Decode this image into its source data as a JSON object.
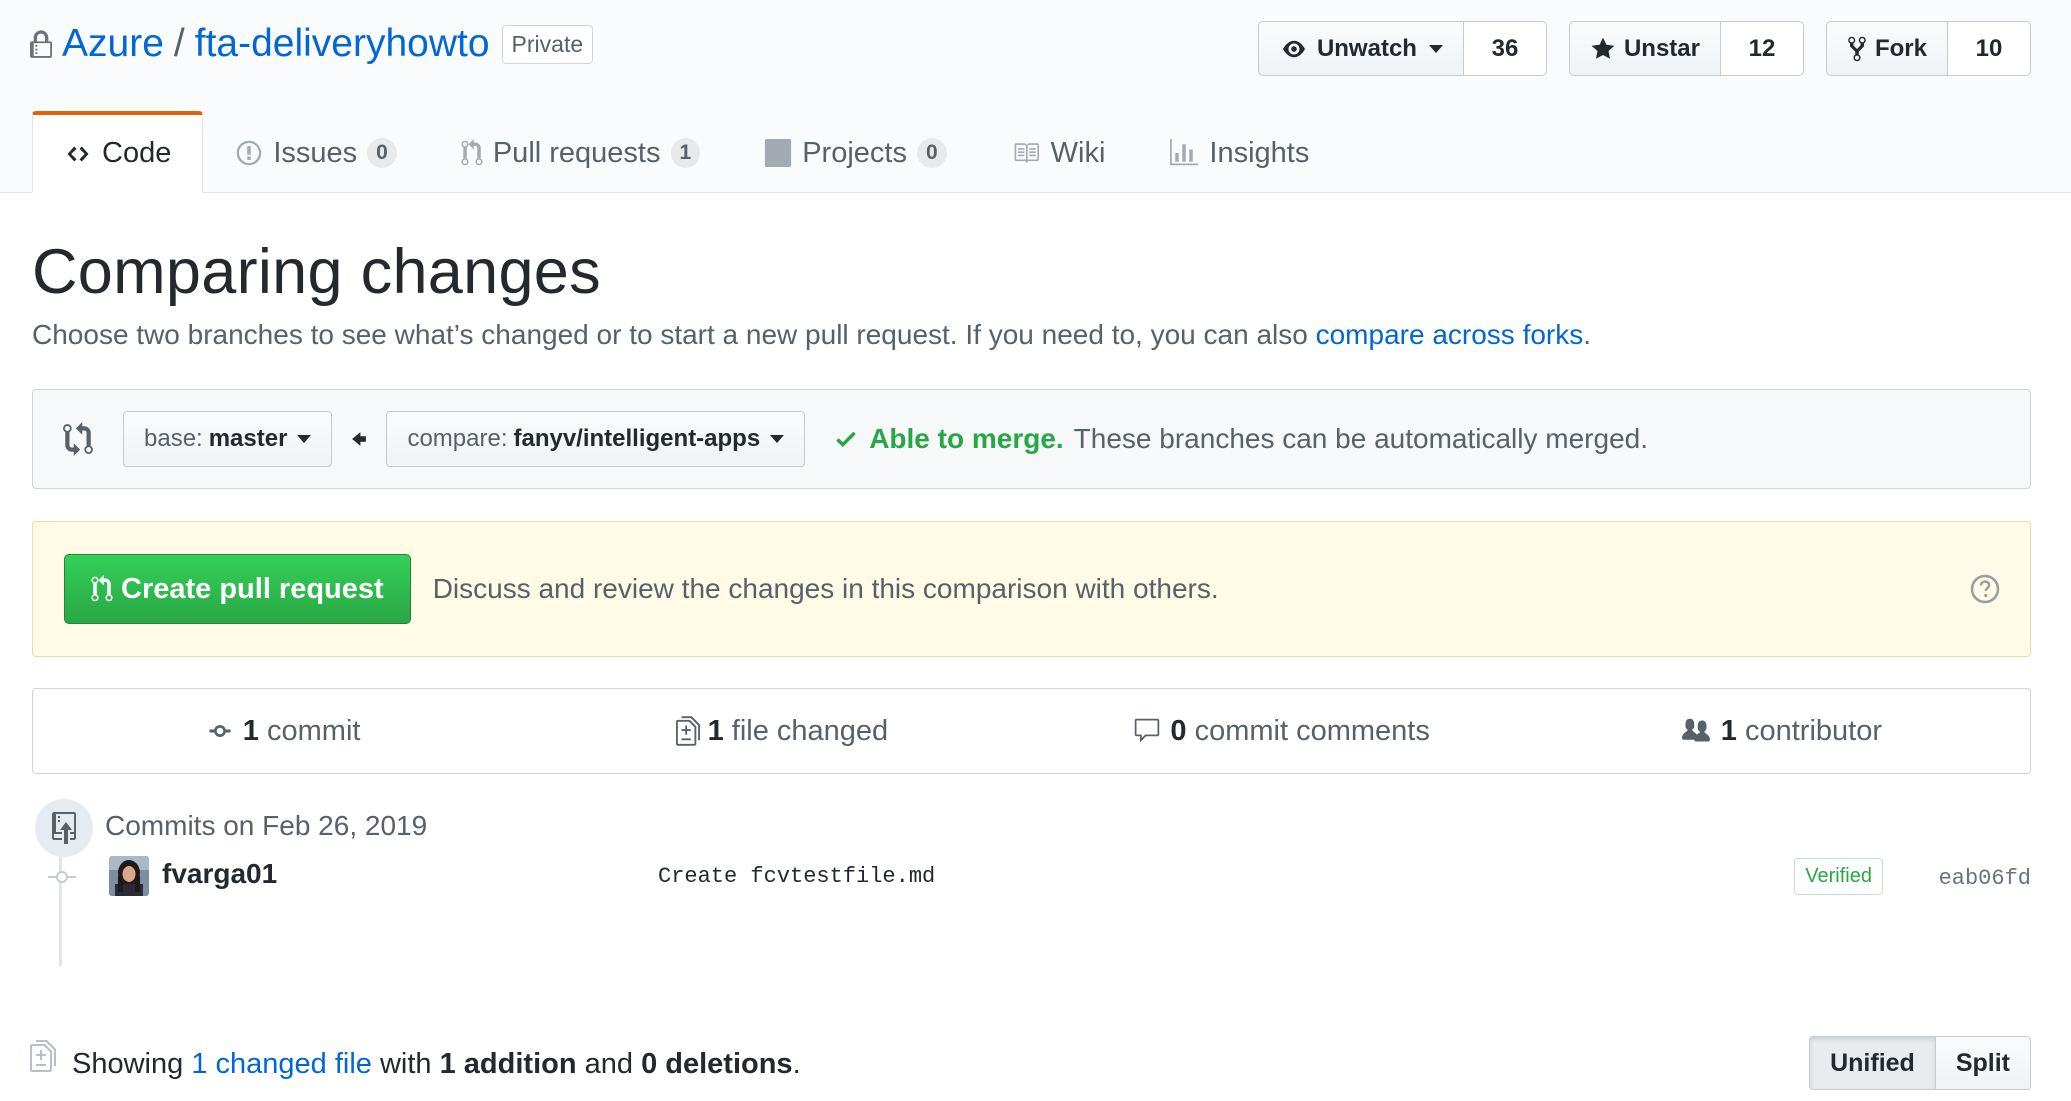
{
  "repo": {
    "owner": "Azure",
    "separator": "/",
    "name": "fta-deliveryhowto",
    "visibility": "Private"
  },
  "actions": {
    "watch": {
      "label": "Unwatch",
      "count": "36"
    },
    "star": {
      "label": "Unstar",
      "count": "12"
    },
    "fork": {
      "label": "Fork",
      "count": "10"
    }
  },
  "nav": {
    "code": {
      "label": "Code"
    },
    "issues": {
      "label": "Issues",
      "count": "0"
    },
    "pulls": {
      "label": "Pull requests",
      "count": "1"
    },
    "projects": {
      "label": "Projects",
      "count": "0"
    },
    "wiki": {
      "label": "Wiki"
    },
    "insights": {
      "label": "Insights"
    }
  },
  "page": {
    "title": "Comparing changes",
    "description": "Choose two branches to see what’s changed or to start a new pull request. If you need to, you can also ",
    "description_link": "compare across forks",
    "description_end": "."
  },
  "range": {
    "base_prefix": "base:",
    "base_value": "master",
    "compare_prefix": "compare:",
    "compare_value": "fanyv/intelligent-apps",
    "merge_status": "Able to merge.",
    "merge_detail": "These branches can be automatically merged."
  },
  "pr_box": {
    "button_label": "Create pull request",
    "message": "Discuss and review the changes in this comparison with others."
  },
  "stats": {
    "commits": {
      "count": "1",
      "label": "commit"
    },
    "files": {
      "count": "1",
      "label": "file changed"
    },
    "comments": {
      "count": "0",
      "label": "commit comments"
    },
    "contributors": {
      "count": "1",
      "label": "contributor"
    }
  },
  "commits": {
    "date_label": "Commits on Feb 26, 2019",
    "items": [
      {
        "author": "fvarga01",
        "message": "Create fcvtestfile.md",
        "badge": "Verified",
        "sha": "eab06fd"
      }
    ]
  },
  "diff_summary": {
    "showing": "Showing",
    "link": "1 changed file",
    "with": "with",
    "additions": "1 addition",
    "and": "and",
    "deletions": "0 deletions",
    "end": "."
  },
  "diff_view": {
    "unified": "Unified",
    "split": "Split",
    "selected": "Unified"
  },
  "colors": {
    "link": "#0366d6",
    "success": "#28a745",
    "tab_accent": "#e36209",
    "flash_warn_bg": "#fffbe6"
  }
}
